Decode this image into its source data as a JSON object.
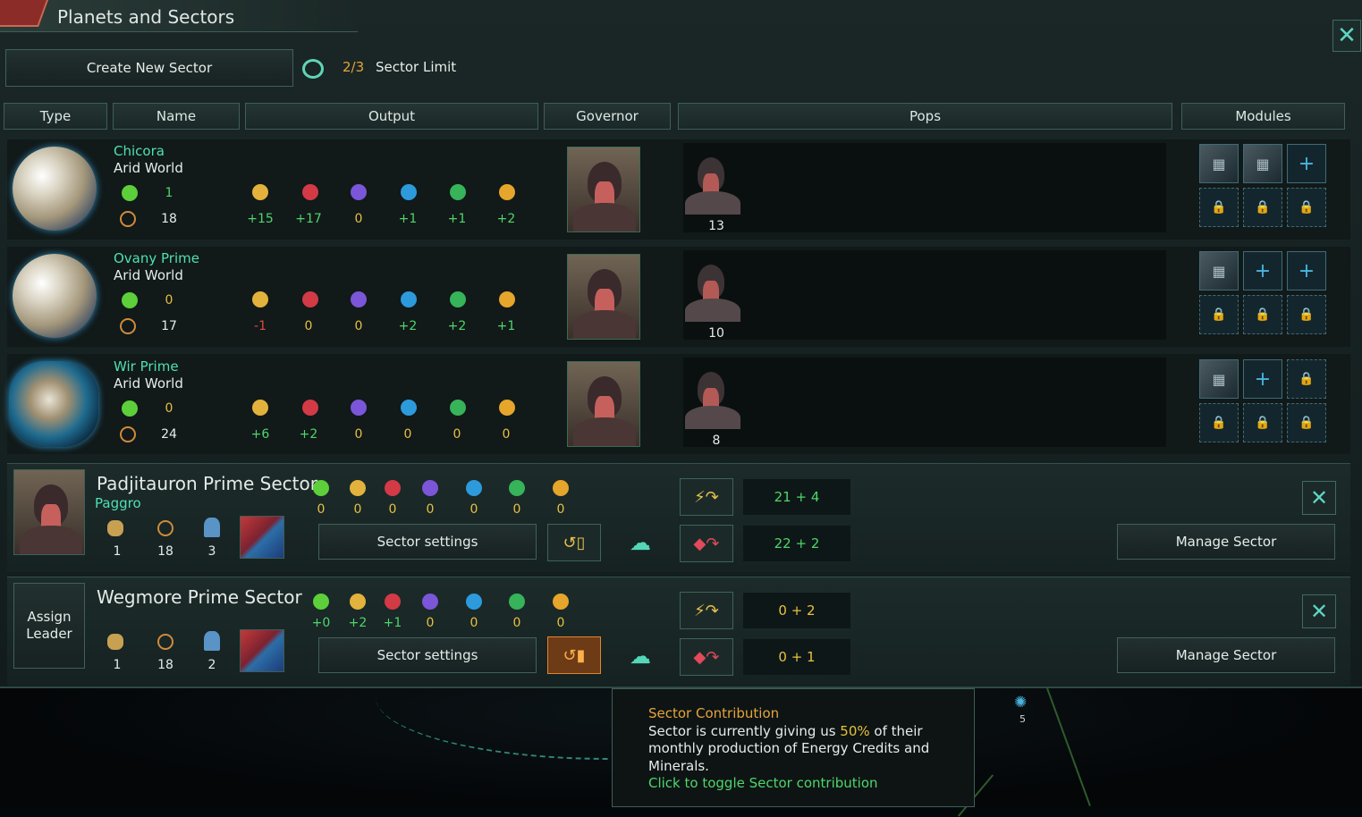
{
  "window": {
    "title": "Planets and Sectors"
  },
  "toolbar": {
    "create_sector": "Create New Sector",
    "sector_limit_value": "2/3",
    "sector_limit_label": "Sector Limit"
  },
  "columns": {
    "type": "Type",
    "name": "Name",
    "output": "Output",
    "governor": "Governor",
    "pops": "Pops",
    "modules": "Modules"
  },
  "planets": [
    {
      "name": "Chicora",
      "class": "Arid World",
      "food": "1",
      "stability": "18",
      "output": [
        "+15",
        "+17",
        "0",
        "+1",
        "+1",
        "+2"
      ],
      "pops": "13"
    },
    {
      "name": "Ovany Prime",
      "class": "Arid World",
      "food": "0",
      "stability": "17",
      "output": [
        "-1",
        "0",
        "0",
        "+2",
        "+2",
        "+1"
      ],
      "pops": "10"
    },
    {
      "name": "Wir Prime",
      "class": "Arid World",
      "food": "0",
      "stability": "24",
      "output": [
        "+6",
        "+2",
        "0",
        "0",
        "0",
        "0"
      ],
      "pops": "8"
    }
  ],
  "sectors": [
    {
      "name": "Padjitauron Prime Sector",
      "leader": "Paggro",
      "output": [
        "0",
        "0",
        "0",
        "0",
        "0",
        "0",
        "0"
      ],
      "planets": "1",
      "stability": "18",
      "pops": "3",
      "settings": "Sector settings",
      "energy": "21 + 4",
      "minerals": "22 + 2",
      "manage": "Manage Sector"
    },
    {
      "name": "Wegmore Prime Sector",
      "leader_button": "Assign Leader",
      "output": [
        "+0",
        "+2",
        "+1",
        "0",
        "0",
        "0",
        "0"
      ],
      "planets": "1",
      "stability": "18",
      "pops": "2",
      "settings": "Sector settings",
      "energy": "0 + 2",
      "minerals": "0 + 1",
      "manage": "Manage Sector"
    }
  ],
  "tooltip": {
    "title": "Sector Contribution",
    "line_a": "Sector is currently giving us ",
    "percent": "50%",
    "line_b": " of their monthly production of Energy Credits and Minerals.",
    "cta": "Click to toggle Sector contribution"
  },
  "map": {
    "node_count": "5"
  },
  "colors": {
    "accent": "#4fe0b0",
    "positive": "#4ed66b",
    "negative": "#e04a3c",
    "neutral": "#e6c142",
    "highlight": "#e5a43a"
  },
  "icons": [
    "food-icon",
    "energy-icon",
    "minerals-icon",
    "influence-icon",
    "physics-icon",
    "society-icon",
    "engineering-icon",
    "stability-icon",
    "lock-icon",
    "plus-icon",
    "close-icon",
    "planet-icon",
    "pop-icon",
    "contribution-toggle-icon"
  ]
}
